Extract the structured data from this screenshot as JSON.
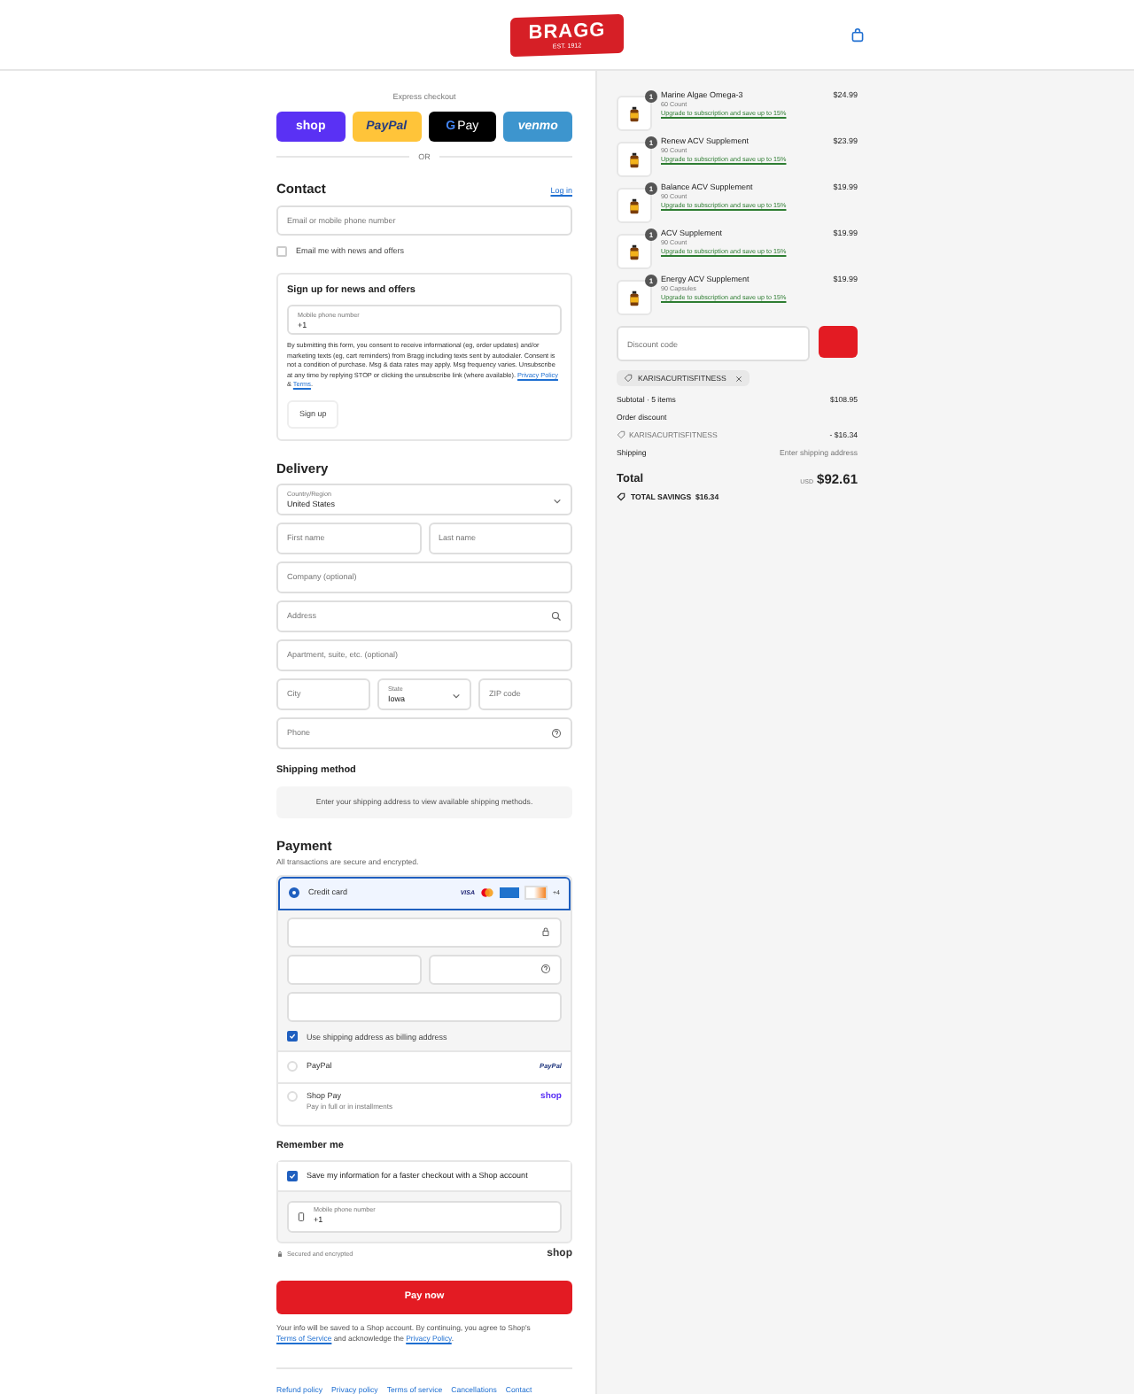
{
  "header": {
    "logo_text": "BRAGG",
    "logo_subtext": "EST. 1912"
  },
  "express": {
    "label": "Express checkout",
    "or_label": "OR",
    "buttons": [
      {
        "kind": "shop",
        "label": "shop"
      },
      {
        "kind": "paypal",
        "label": "PayPal"
      },
      {
        "kind": "gpay",
        "prefix": "G",
        "label": "Pay"
      },
      {
        "kind": "venmo",
        "label": "venmo"
      }
    ]
  },
  "contact": {
    "heading": "Contact",
    "login_link": "Log in",
    "email_placeholder": "Email or mobile phone number",
    "news_checkbox": {
      "label": "Email me with news and offers",
      "checked": false
    },
    "signup": {
      "heading": "Sign up for news and offers",
      "phone_label": "Mobile phone number",
      "phone_value": "+1",
      "consent": {
        "text": "By submitting this form, you consent to receive informational (eg, order updates) and/or marketing texts (eg, cart reminders) from Bragg including texts sent by autodialer. Consent is not a condition of purchase. Msg & data rates may apply. Msg frequency varies. Unsubscribe at any time by replying STOP or clicking the unsubscribe link (where available).",
        "privacy_link": "Privacy Policy",
        "joiner": "&",
        "terms_link": "Terms",
        "end": "."
      },
      "button": "Sign up"
    }
  },
  "delivery": {
    "heading": "Delivery",
    "rows": [
      [
        {
          "kind": "select",
          "label": "Country/Region",
          "value": "United States"
        }
      ],
      [
        {
          "kind": "input",
          "placeholder": "First name"
        },
        {
          "kind": "input",
          "placeholder": "Last name"
        }
      ],
      [
        {
          "kind": "input",
          "placeholder": "Company (optional)"
        }
      ],
      [
        {
          "kind": "search",
          "placeholder": "Address"
        }
      ],
      [
        {
          "kind": "input",
          "placeholder": "Apartment, suite, etc. (optional)"
        }
      ],
      [
        {
          "kind": "input",
          "placeholder": "City"
        },
        {
          "kind": "select",
          "label": "State",
          "value": "Iowa"
        },
        {
          "kind": "input",
          "placeholder": "ZIP code"
        }
      ],
      [
        {
          "kind": "help",
          "placeholder": "Phone"
        }
      ]
    ]
  },
  "shipping": {
    "heading": "Shipping method",
    "notice": "Enter your shipping address to view available shipping methods."
  },
  "payment": {
    "heading": "Payment",
    "subtitle": "All transactions are secure and encrypted.",
    "methods": [
      {
        "kind": "card",
        "label": "Credit card",
        "selected": true,
        "brand_visa": "VISA",
        "brand_more": "+4"
      },
      {
        "kind": "paypal",
        "label": "PayPal",
        "selected": false,
        "logo": "PayPal"
      },
      {
        "kind": "shoppay",
        "label": "Shop Pay",
        "sublabel": "Pay in full or in installments",
        "selected": false,
        "logo": "shop"
      }
    ],
    "billing_checkbox": {
      "label": "Use shipping address as billing address",
      "checked": true
    }
  },
  "remember": {
    "heading": "Remember me",
    "save_checkbox": {
      "label": "Save my information for a faster checkout with a Shop account",
      "checked": true
    },
    "phone_label": "Mobile phone number",
    "phone_value": "+1",
    "secure_text": "Secured and encrypted",
    "shop_logo": "shop"
  },
  "pay_button": "Pay now",
  "notice": {
    "before": "Your info will be saved to a Shop account. By continuing, you agree to Shop's",
    "terms_link": "Terms of Service",
    "middle": "and acknowledge the",
    "privacy_link": "Privacy Policy",
    "end": "."
  },
  "footer_links": [
    "Refund policy",
    "Privacy policy",
    "Terms of service",
    "Cancellations",
    "Contact"
  ],
  "cart": {
    "items": [
      {
        "name": "Marine Algae Omega-3",
        "variant": "60 Count",
        "upsell": "Upgrade to subscription and save up to 15%",
        "price": "$24.99",
        "quantity": "1"
      },
      {
        "name": "Renew ACV Supplement",
        "variant": "90 Count",
        "upsell": "Upgrade to subscription and save up to 15%",
        "price": "$23.99",
        "quantity": "1"
      },
      {
        "name": "Balance ACV Supplement",
        "variant": "90 Count",
        "upsell": "Upgrade to subscription and save up to 15%",
        "price": "$19.99",
        "quantity": "1"
      },
      {
        "name": "ACV Supplement",
        "variant": "90 Count",
        "upsell": "Upgrade to subscription and save up to 15%",
        "price": "$19.99",
        "quantity": "1"
      },
      {
        "name": "Energy ACV Supplement",
        "variant": "90 Capsules",
        "upsell": "Upgrade to subscription and save up to 15%",
        "price": "$19.99",
        "quantity": "1"
      }
    ],
    "discount_placeholder": "Discount code",
    "applied_code": "KARISACURTISFITNESS",
    "subtotal_label": "Subtotal · 5 items",
    "subtotal_value": "$108.95",
    "discount_label": "Order discount",
    "discount_code": "KARISACURTISFITNESS",
    "discount_value": "- $16.34",
    "shipping_label": "Shipping",
    "shipping_value": "Enter shipping address",
    "total_label": "Total",
    "total_currency": "USD",
    "total_value": "$92.61",
    "savings": "**TOTAL SAVINGS  $16.34**"
  }
}
